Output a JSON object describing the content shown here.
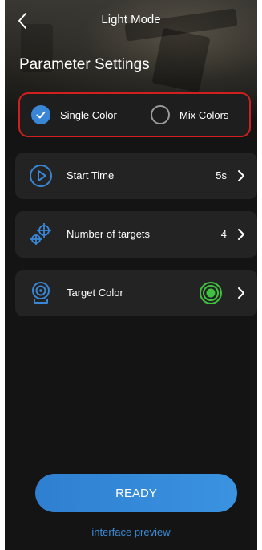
{
  "header": {
    "title": "Light Mode"
  },
  "section_title": "Parameter Settings",
  "mode": {
    "single_label": "Single Color",
    "mix_label": "Mix Colors",
    "selected": "single"
  },
  "rows": [
    {
      "label": "Start Time",
      "value": "5s",
      "icon": "play-circle-icon"
    },
    {
      "label": "Number of targets",
      "value": "4",
      "icon": "crosshair-targets-icon"
    },
    {
      "label": "Target Color",
      "value": "",
      "icon": "target-sensor-icon"
    }
  ],
  "target_color": "#3fc23f",
  "ready_label": "READY",
  "preview_label": "interface preview",
  "colors": {
    "accent": "#3a86d6",
    "highlight_border": "#d11f1f",
    "card_bg": "#232323",
    "screen_bg": "#141414"
  }
}
